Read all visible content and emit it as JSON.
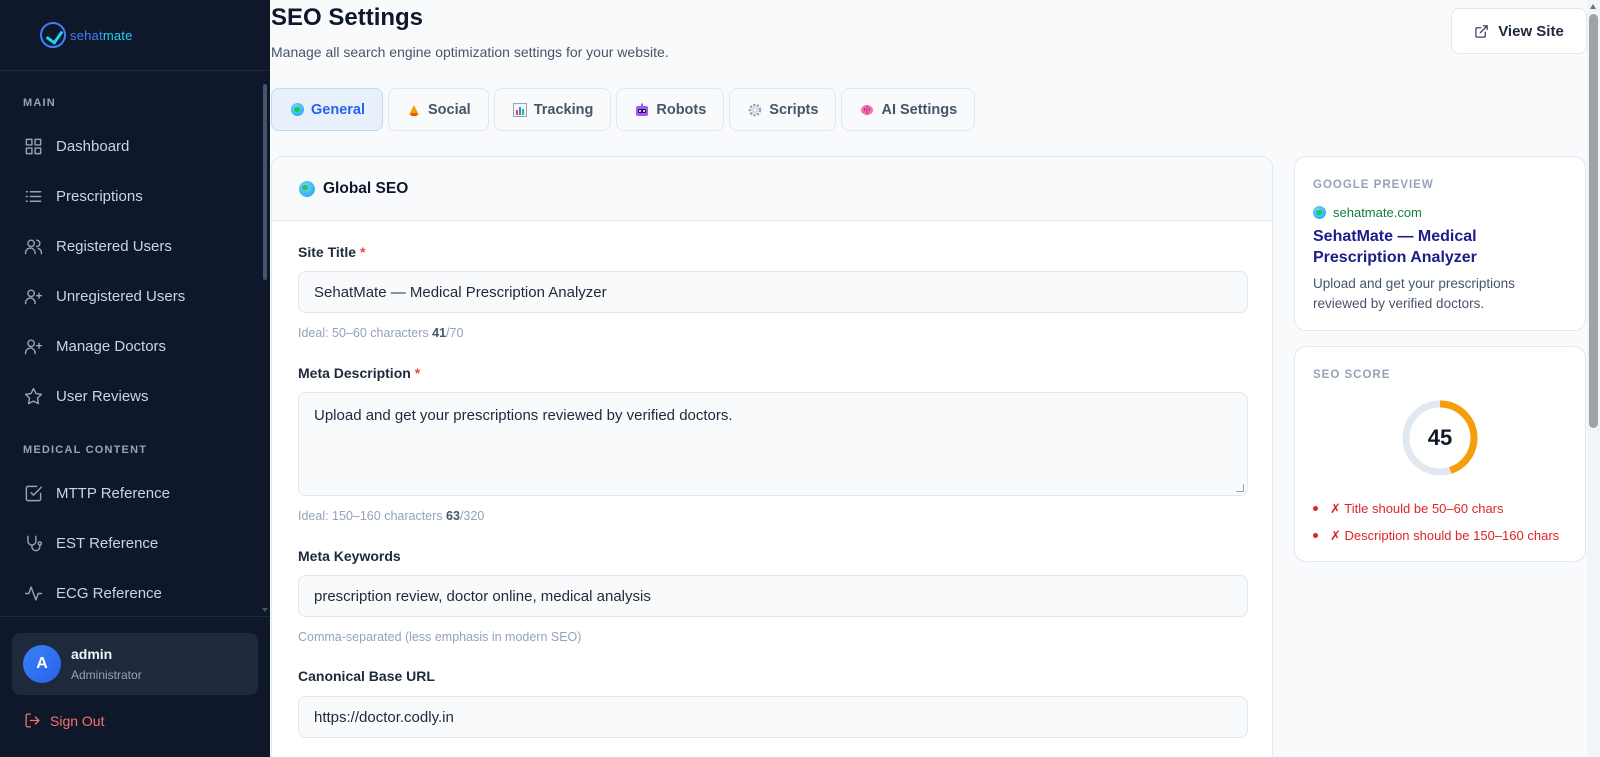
{
  "sidebar": {
    "logo_text_a": "sehat",
    "logo_text_b": "mate",
    "sections": [
      {
        "label": "MAIN"
      },
      {
        "label": "MEDICAL CONTENT"
      }
    ],
    "items": [
      {
        "label": "Dashboard",
        "icon": "grid-icon"
      },
      {
        "label": "Prescriptions",
        "icon": "list-icon"
      },
      {
        "label": "Registered Users",
        "icon": "users-icon"
      },
      {
        "label": "Unregistered Users",
        "icon": "user-plus-icon"
      },
      {
        "label": "Manage Doctors",
        "icon": "user-plus-icon"
      },
      {
        "label": "User Reviews",
        "icon": "star-icon"
      },
      {
        "label": "MTTP Reference",
        "icon": "check-square-icon"
      },
      {
        "label": "EST Reference",
        "icon": "stethoscope-icon"
      },
      {
        "label": "ECG Reference",
        "icon": "activity-icon"
      }
    ],
    "user": {
      "initial": "A",
      "name": "admin",
      "role": "Administrator"
    },
    "signout_label": "Sign Out"
  },
  "header": {
    "title": "SEO Settings",
    "subtitle": "Manage all search engine optimization settings for your website.",
    "view_site_label": "View Site"
  },
  "tabs": [
    {
      "label": "General",
      "icon": "globe-icon",
      "active": true
    },
    {
      "label": "Social",
      "icon": "megaphone-icon"
    },
    {
      "label": "Tracking",
      "icon": "bar-chart-icon"
    },
    {
      "label": "Robots",
      "icon": "robot-icon"
    },
    {
      "label": "Scripts",
      "icon": "gear-icon"
    },
    {
      "label": "AI Settings",
      "icon": "brain-icon"
    }
  ],
  "global_seo": {
    "heading": "Global SEO",
    "site_title": {
      "label": "Site Title",
      "required_mark": "*",
      "value": "SehatMate — Medical Prescription Analyzer",
      "hint": "Ideal: 50–60 characters",
      "count": "41",
      "max": "/70"
    },
    "meta_description": {
      "label": "Meta Description",
      "required_mark": "*",
      "value": "Upload and get your prescriptions reviewed by verified doctors.",
      "hint": "Ideal: 150–160 characters",
      "count": "63",
      "max": "/320"
    },
    "meta_keywords": {
      "label": "Meta Keywords",
      "value": "prescription review, doctor online, medical analysis",
      "hint": "Comma-separated (less emphasis in modern SEO)"
    },
    "canonical": {
      "label": "Canonical Base URL",
      "value": "https://doctor.codly.in"
    }
  },
  "google_preview": {
    "label": "GOOGLE PREVIEW",
    "url": "sehatmate.com",
    "title": "SehatMate — Medical Prescription Analyzer",
    "description": "Upload and get your prescriptions reviewed by verified doctors."
  },
  "seo_score": {
    "label": "SEO SCORE",
    "score": "45",
    "score_fraction": 0.45,
    "issues": [
      "✗ Title should be 50–60 chars",
      "✗ Description should be 150–160 chars"
    ]
  },
  "colors": {
    "sidebar_bg": "#0f172a",
    "accent": "#2563eb",
    "score_ring": "#f59e0b",
    "error": "#dc2626"
  }
}
